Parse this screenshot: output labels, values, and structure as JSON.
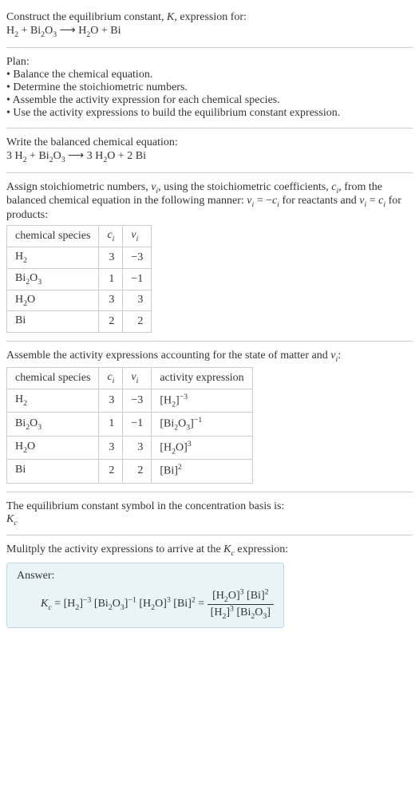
{
  "intro": {
    "line1_pre": "Construct the equilibrium constant, ",
    "line1_K": "K",
    "line1_post": ", expression for:",
    "eq_lhs1": "H",
    "eq_lhs1_sub": "2",
    "plus": " + ",
    "eq_lhs2": "Bi",
    "eq_lhs2_sub": "2",
    "eq_lhs2b": "O",
    "eq_lhs2b_sub": "3",
    "arrow": " ⟶ ",
    "eq_rhs1": "H",
    "eq_rhs1_sub": "2",
    "eq_rhs1b": "O",
    "eq_rhs2": "Bi"
  },
  "plan": {
    "title": "Plan:",
    "b1": "• Balance the chemical equation.",
    "b2": "• Determine the stoichiometric numbers.",
    "b3": "• Assemble the activity expression for each chemical species.",
    "b4": "• Use the activity expressions to build the equilibrium constant expression."
  },
  "balanced": {
    "title": "Write the balanced chemical equation:",
    "c1": "3 ",
    "c2": "2 "
  },
  "stoich": {
    "text_a": "Assign stoichiometric numbers, ",
    "nu": "ν",
    "nu_sub": "i",
    "text_b": ", using the stoichiometric coefficients, ",
    "c": "c",
    "c_sub": "i",
    "text_c": ", from the balanced chemical equation in the following manner: ",
    "rel_react": " = −",
    "text_d": " for reactants and ",
    "rel_prod": " = ",
    "text_e": " for products:",
    "hdr_species": "chemical species",
    "hdr_c": "c",
    "hdr_c_sub": "i",
    "hdr_nu": "ν",
    "hdr_nu_sub": "i",
    "rows": [
      {
        "sp": "H",
        "sp_sub": "2",
        "sp2": "",
        "sp2_sub": "",
        "c": "3",
        "nu": "−3"
      },
      {
        "sp": "Bi",
        "sp_sub": "2",
        "sp2": "O",
        "sp2_sub": "3",
        "c": "1",
        "nu": "−1"
      },
      {
        "sp": "H",
        "sp_sub": "2",
        "sp2": "O",
        "sp2_sub": "",
        "c": "3",
        "nu": "3"
      },
      {
        "sp": "Bi",
        "sp_sub": "",
        "sp2": "",
        "sp2_sub": "",
        "c": "2",
        "nu": "2"
      }
    ]
  },
  "activity": {
    "title_a": "Assemble the activity expressions accounting for the state of matter and ",
    "title_b": ":",
    "hdr_act": "activity expression",
    "rows": [
      {
        "sp": "H",
        "sp_sub": "2",
        "sp2": "",
        "sp2_sub": "",
        "c": "3",
        "nu": "−3",
        "exp": "−3"
      },
      {
        "sp": "Bi",
        "sp_sub": "2",
        "sp2": "O",
        "sp2_sub": "3",
        "c": "1",
        "nu": "−1",
        "exp": "−1"
      },
      {
        "sp": "H",
        "sp_sub": "2",
        "sp2": "O",
        "sp2_sub": "",
        "c": "3",
        "nu": "3",
        "exp": "3"
      },
      {
        "sp": "Bi",
        "sp_sub": "",
        "sp2": "",
        "sp2_sub": "",
        "c": "2",
        "nu": "2",
        "exp": "2"
      }
    ]
  },
  "symbol": {
    "text": "The equilibrium constant symbol in the concentration basis is:",
    "Kc_K": "K",
    "Kc_sub": "c"
  },
  "final": {
    "title_a": "Mulitply the activity expressions to arrive at the ",
    "title_b": " expression:",
    "answer_label": "Answer:",
    "eq_eq": " = ",
    "h2": "H",
    "h2_sub": "2",
    "bi2o3_a": "Bi",
    "bi2o3_a_sub": "2",
    "bi2o3_b": "O",
    "bi2o3_b_sub": "3",
    "h2o_a": "H",
    "h2o_a_sub": "2",
    "h2o_b": "O",
    "bi": "Bi",
    "exp_m3": "−3",
    "exp_m1": "−1",
    "exp_3": "3",
    "exp_2": "2"
  },
  "brackets": {
    "l": "[",
    "r": "]"
  }
}
